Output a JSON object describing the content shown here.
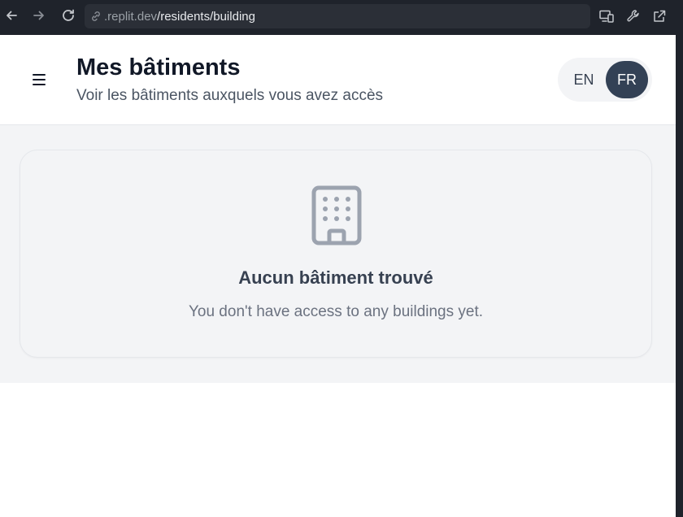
{
  "browser": {
    "url_domain": ".replit.dev",
    "url_path": "/residents/building"
  },
  "header": {
    "title": "Mes bâtiments",
    "subtitle": "Voir les bâtiments auxquels vous avez accès"
  },
  "language": {
    "options": [
      "EN",
      "FR"
    ],
    "selected": "FR"
  },
  "empty_state": {
    "icon": "building-icon",
    "title": "Aucun bâtiment trouvé",
    "description": "You don't have access to any buildings yet."
  },
  "colors": {
    "chrome_bg": "#1f232b",
    "active_lang_bg": "#334155",
    "content_bg": "#f3f4f6",
    "icon_gray": "#9ca3af"
  }
}
